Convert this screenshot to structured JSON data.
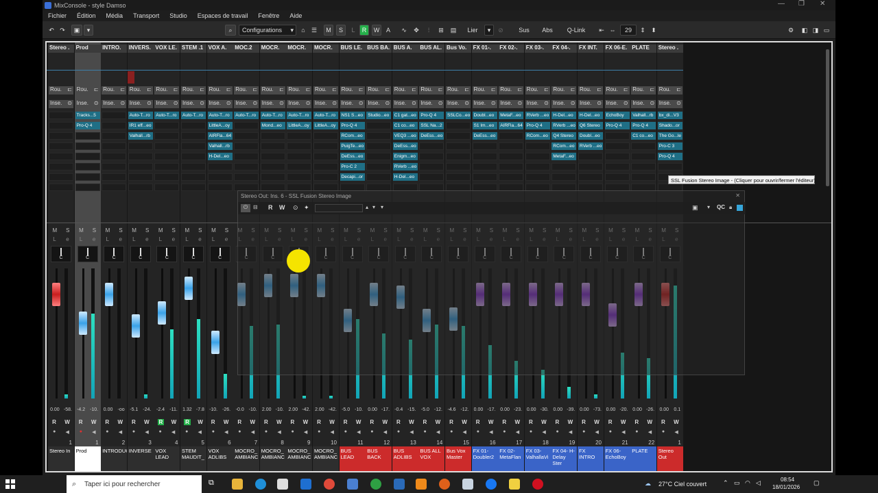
{
  "window": {
    "title": "MixConsole - style Damso"
  },
  "menu": [
    "Fichier",
    "Édition",
    "Média",
    "Transport",
    "Studio",
    "Espaces de travail",
    "Fenêtre",
    "Aide"
  ],
  "toolbar": {
    "configurations": "Configurations",
    "m": "M",
    "s": "S",
    "l": "L",
    "r": "R",
    "w": "W",
    "a": "A",
    "lier": "Lier",
    "sus": "Sus",
    "abs": "Abs",
    "qlink": "Q-Link",
    "count": "29"
  },
  "plugin_window": {
    "title": "Stereo Out: Ins. 6 - SSL Fusion Stereo Image",
    "r": "R",
    "w": "W",
    "qc": "QC"
  },
  "tooltip": "SSL Fusion Stereo Image - (Cliquer pour ouvrir/fermer l'éditeur)",
  "channels": [
    {
      "header": "Stereo .",
      "label": "Stereo In",
      "num": "1",
      "vals": [
        "0.00",
        "-58."
      ],
      "color": "#2e2e2e",
      "fader": "red",
      "fp": 0.2,
      "lvl": 0.03,
      "plugins": []
    },
    {
      "header": "Prod",
      "label": "Prod",
      "num": "1",
      "vals": [
        "-4.2",
        "-10."
      ],
      "color": "#ffffff",
      "fader": "blue",
      "fp": 0.42,
      "lvl": 0.65,
      "plugins": [
        "Tracks...5",
        "Pro-Q 4"
      ]
    },
    {
      "header": "INTRO.",
      "label": "INTRODUCTION",
      "num": "2",
      "vals": [
        "0.00",
        "-oo"
      ],
      "color": "#2e2e2e",
      "fader": "blue",
      "fp": 0.2,
      "lvl": 0,
      "plugins": []
    },
    {
      "header": "INVERS.",
      "label": "INVERSE",
      "num": "3",
      "vals": [
        "-5.1",
        "-24."
      ],
      "color": "#2e2e2e",
      "fader": "blue",
      "fp": 0.44,
      "lvl": 0.03,
      "plugins": [
        "Auto-T...ro",
        "IR1 eff...eo",
        "Valhall...rb"
      ]
    },
    {
      "header": "VOX LE.",
      "label": "VOX LEAD",
      "num": "4",
      "vals": [
        "-2.4",
        "-11."
      ],
      "color": "#2e2e2e",
      "fader": "blue",
      "fp": 0.34,
      "lvl": 0.53,
      "plugins": [
        "Auto-T...ro"
      ]
    },
    {
      "header": "STEM .1",
      "label": "STEM MAUDIT_",
      "num": "5",
      "vals": [
        "1.32",
        "-7.8"
      ],
      "color": "#2e2e2e",
      "fader": "blue",
      "fp": 0.15,
      "lvl": 0.61,
      "plugins": [
        "Auto-T...ro"
      ]
    },
    {
      "header": "VOX A.",
      "label": "VOX ADLIBS",
      "num": "6",
      "vals": [
        "-10.",
        "-26."
      ],
      "color": "#2e2e2e",
      "fader": "blue",
      "fp": 0.57,
      "lvl": 0.19,
      "plugins": [
        "Auto-T...ro",
        "LittleA...oy",
        "AIRFla...64",
        "Valhall...rb",
        "H-Del...eo"
      ]
    },
    {
      "header": "MOC.2",
      "label": "MOCRO_ AMBIANC",
      "num": "7",
      "vals": [
        "-0.0",
        "-10."
      ],
      "color": "#2e2e2e",
      "fader": "blue",
      "fp": 0.2,
      "lvl": 0.56,
      "plugins": [
        "Auto-T...ro"
      ]
    },
    {
      "header": "MOCR.",
      "label": "MOCRO_ AMBIANC",
      "num": "8",
      "vals": [
        "2.00",
        "-10."
      ],
      "color": "#2e2e2e",
      "fader": "blue",
      "fp": 0.13,
      "lvl": 0.57,
      "plugins": [
        "Auto-T...ro",
        "Mond...eo"
      ]
    },
    {
      "header": "MOCR.",
      "label": "MOCRO_ AMBIANC",
      "num": "9",
      "vals": [
        "2.00",
        "-42."
      ],
      "color": "#2e2e2e",
      "fader": "blue",
      "fp": 0.13,
      "lvl": 0.02,
      "plugins": [
        "Auto-T...ro",
        "LittleA...oy"
      ]
    },
    {
      "header": "MOCR.",
      "label": "MOCRO_ AMBIANC",
      "num": "10",
      "vals": [
        "2.00",
        "-42."
      ],
      "color": "#2e2e2e",
      "fader": "blue",
      "fp": 0.13,
      "lvl": 0.02,
      "plugins": [
        "Auto-T...ro",
        "LittleA...oy"
      ]
    },
    {
      "header": "BUS LE.",
      "label": "BUS LEAD",
      "num": "11",
      "vals": [
        "-5.0",
        "-10."
      ],
      "color": "#cc2b2b",
      "fader": "blue",
      "fp": 0.4,
      "lvl": 0.61,
      "plugins": [
        "NS1 S...eo",
        "Pro-Q 4",
        "RCom...eo",
        "PuigTe...eo",
        "DeEss...eo",
        "Pro-C 2",
        "Decapi...or"
      ]
    },
    {
      "header": "BUS BA.",
      "label": "BUS BACK",
      "num": "12",
      "vals": [
        "0.00",
        "-17."
      ],
      "color": "#cc2b2b",
      "fader": "blue",
      "fp": 0.2,
      "lvl": 0.5,
      "plugins": [
        "Studio...eo"
      ]
    },
    {
      "header": "BUS A.",
      "label": "BUS ADLIBS",
      "num": "13",
      "vals": [
        "-0.4",
        "-15."
      ],
      "color": "#cc2b2b",
      "fader": "blue",
      "fp": 0.22,
      "lvl": 0.45,
      "plugins": [
        "C1 gat...eo",
        "C1 co...eo",
        "VEQ3 ...eo",
        "DeEss...eo",
        "Enigm...eo",
        "RVerb ...eo",
        "H-Del...eo"
      ]
    },
    {
      "header": "BUS AL.",
      "label": "BUS ALL VOX",
      "num": "14",
      "vals": [
        "-5.0",
        "-12."
      ],
      "color": "#cc2b2b",
      "fader": "blue",
      "fp": 0.4,
      "lvl": 0.57,
      "plugins": [
        "Pro-Q 4",
        "SSL Na...2",
        "DeEss...eo"
      ]
    },
    {
      "header": "Bus Vo.",
      "label": "Bus Vox Master",
      "num": "15",
      "vals": [
        "-4.6",
        "-12."
      ],
      "color": "#cc2b2b",
      "fader": "blue",
      "fp": 0.39,
      "lvl": 0.56,
      "plugins": [
        "SSLCo...eo"
      ]
    },
    {
      "header": "FX 01-.",
      "label": "FX 01- Doubler2",
      "num": "16",
      "vals": [
        "0.00",
        "-17."
      ],
      "color": "#3a64c8",
      "fader": "purple",
      "fp": 0.2,
      "lvl": 0.41,
      "plugins": [
        "Doubl...eo",
        "S1 Im...eo",
        "DeEss...eo"
      ]
    },
    {
      "header": "FX 02-.",
      "label": "FX 02- MetaFlan",
      "num": "17",
      "vals": [
        "0.00",
        "-23."
      ],
      "color": "#3a64c8",
      "fader": "purple",
      "fp": 0.2,
      "lvl": 0.29,
      "plugins": [
        "MetaF...eo",
        "AIRFla...64"
      ]
    },
    {
      "header": "FX 03-.",
      "label": "FX 03- ValhallaVi",
      "num": "18",
      "vals": [
        "0.00",
        "-30."
      ],
      "color": "#3a64c8",
      "fader": "purple",
      "fp": 0.2,
      "lvl": 0.22,
      "plugins": [
        "RVerb ...eo",
        "Pro-Q 4",
        "RCom...eo"
      ]
    },
    {
      "header": "FX 04-.",
      "label": "FX 04- H- Delay Ster",
      "num": "19",
      "vals": [
        "0.00",
        "-39."
      ],
      "color": "#3a64c8",
      "fader": "purple",
      "fp": 0.2,
      "lvl": 0.09,
      "plugins": [
        "H-Del...eo",
        "RVerb ...eo",
        "Q4 Stereo",
        "RCom...eo",
        "MetaF...eo"
      ]
    },
    {
      "header": "FX INT.",
      "label": "FX INTRO",
      "num": "20",
      "vals": [
        "0.00",
        "-73."
      ],
      "color": "#3a64c8",
      "fader": "purple",
      "fp": 0.2,
      "lvl": 0.03,
      "plugins": [
        "H-Del...eo",
        "Q6 Stereo",
        "Doubl...eo",
        "RVerb ...eo"
      ]
    },
    {
      "header": "FX 06-E.",
      "label": "FX 06- EchoBoy",
      "num": "21",
      "vals": [
        "0.00",
        "-20."
      ],
      "color": "#3a64c8",
      "fader": "purple",
      "fp": 0.36,
      "lvl": 0.35,
      "plugins": [
        "EchoBoy",
        "Pro-Q 4"
      ]
    },
    {
      "header": "PLATE",
      "label": "PLATE",
      "num": "22",
      "vals": [
        "0.00",
        "-26."
      ],
      "color": "#3a64c8",
      "fader": "purple",
      "fp": 0.2,
      "lvl": 0.31,
      "plugins": [
        "Valhall...rb",
        "Pro-Q 4",
        "C1 co...eo"
      ]
    },
    {
      "header": "Stereo .",
      "label": "Stereo Out",
      "num": "1",
      "vals": [
        "0.00",
        "0.1"
      ],
      "color": "#cc2b2b",
      "fader": "red",
      "fp": 0.2,
      "lvl": 0.87,
      "plugins": [
        "bx_di...V3",
        "Shado...or",
        "The Go...le",
        "Pro-C 3",
        "Pro-Q 4"
      ]
    }
  ],
  "taskbar": {
    "search": "Taper ici pour rechercher",
    "weather": "27°C  Ciel couvert",
    "time": "08:54",
    "date": "18/01/2026"
  }
}
